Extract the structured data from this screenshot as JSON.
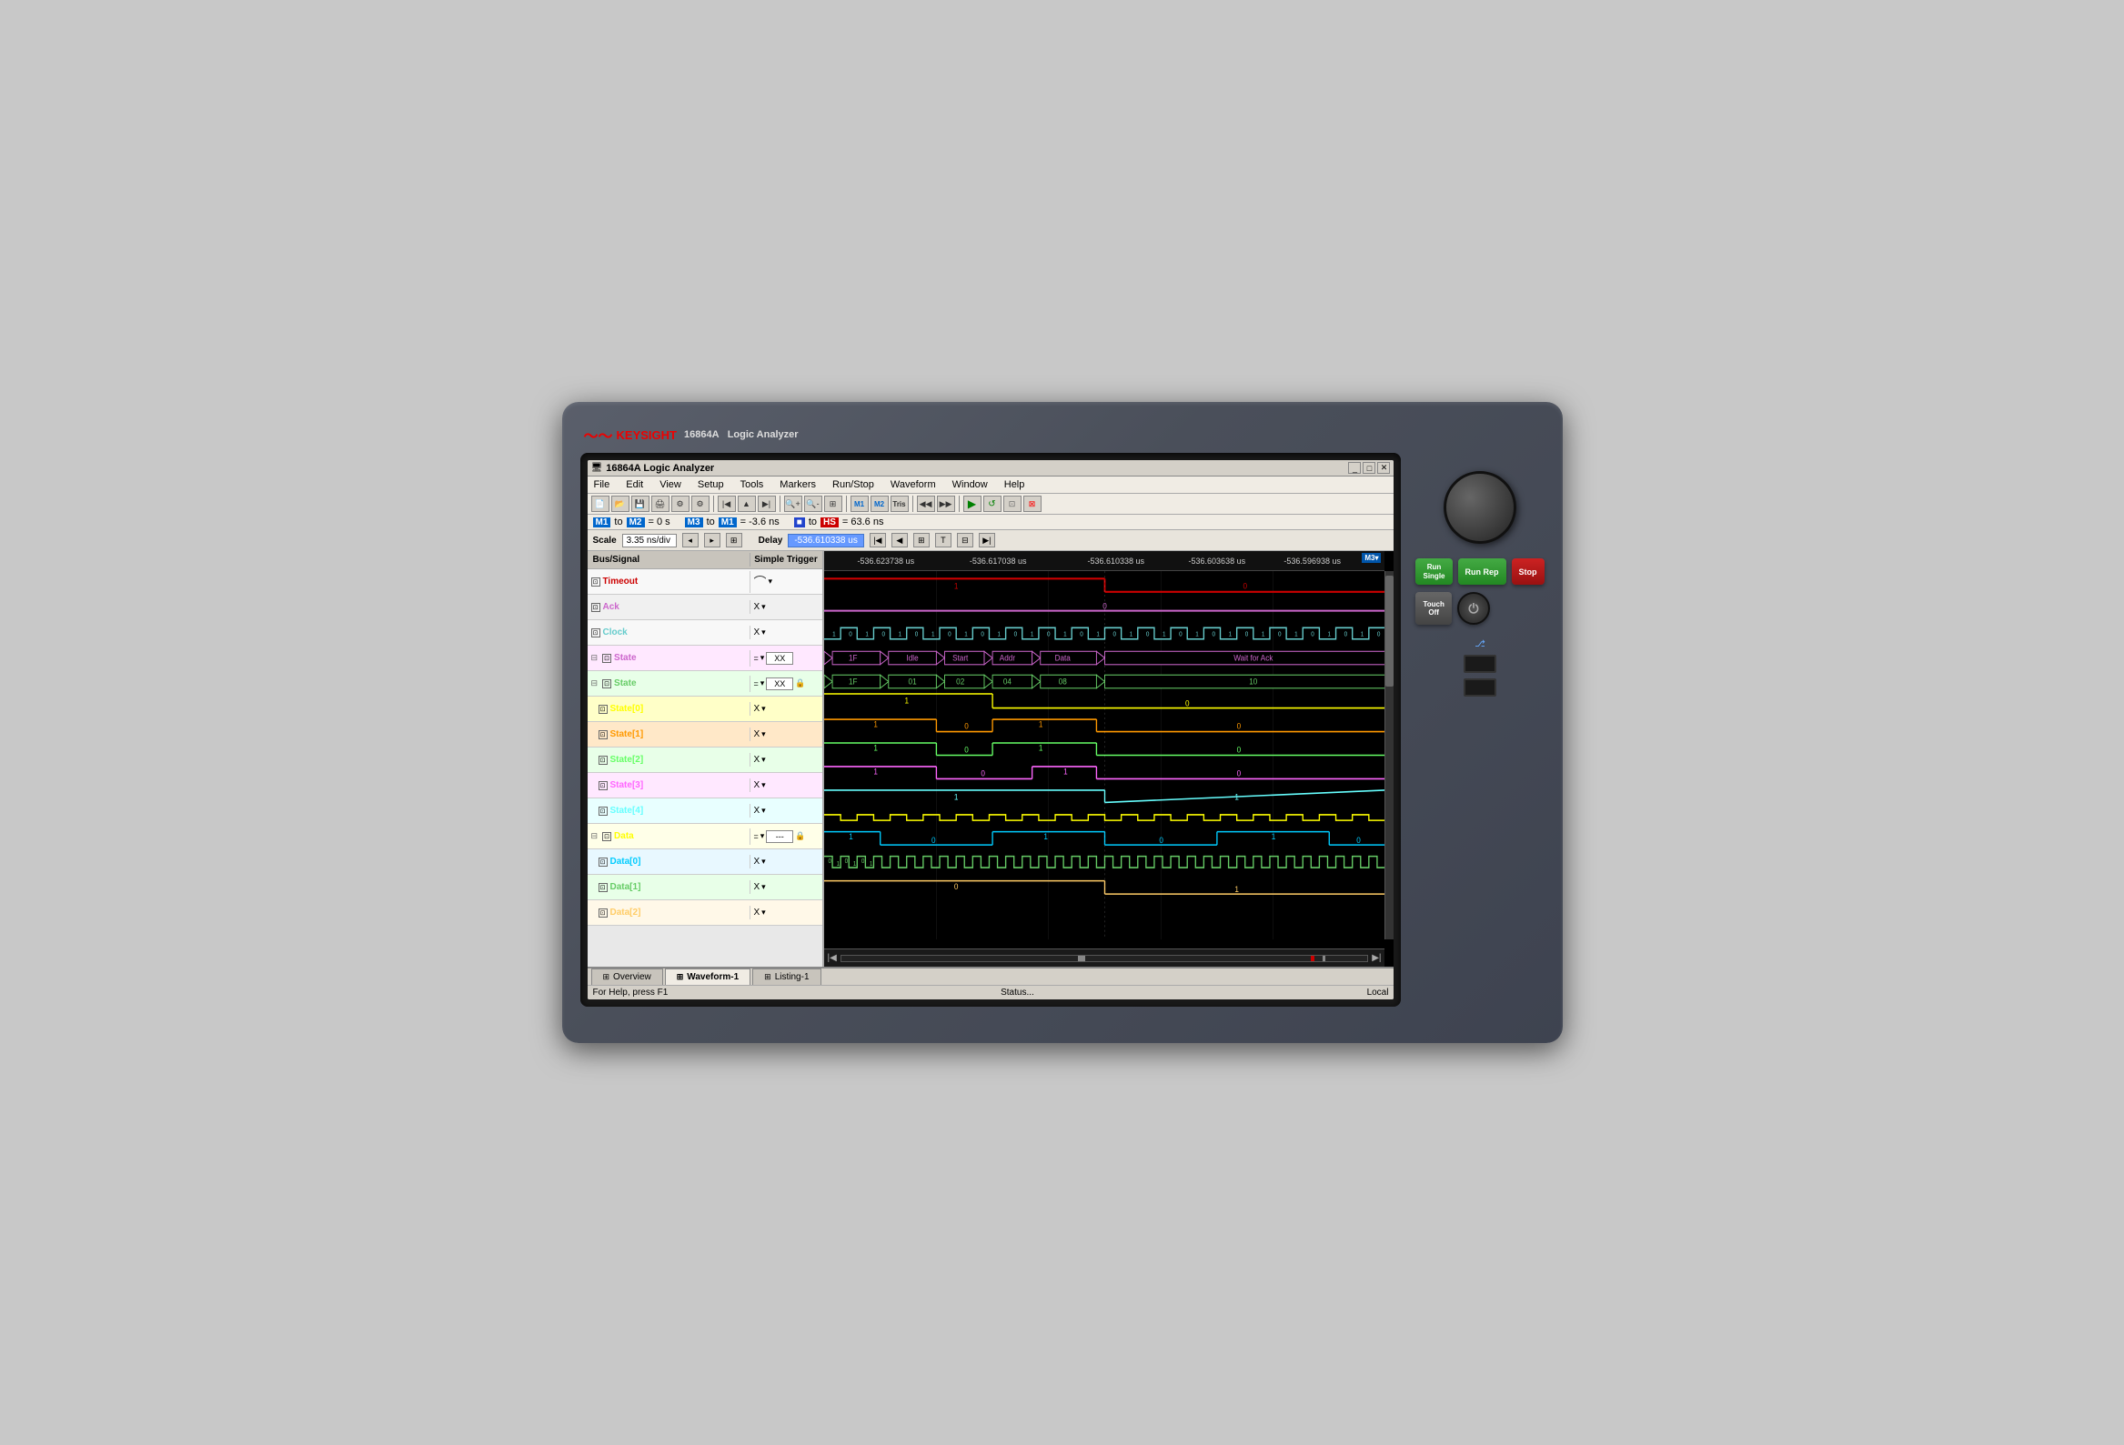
{
  "instrument": {
    "brand": "KEYSIGHT",
    "model": "16864A",
    "type": "Logic Analyzer"
  },
  "window": {
    "title": "16864A  Logic Analyzer",
    "min": "_",
    "max": "□",
    "close": "✕"
  },
  "menu": {
    "items": [
      "File",
      "Edit",
      "View",
      "Setup",
      "Tools",
      "Markers",
      "Run/Stop",
      "Waveform",
      "Window",
      "Help"
    ]
  },
  "status_row": {
    "m1_m2": "M1 to M2 = 0 s",
    "m3_m1": "M3 to M1 = -3.6 ns",
    "blue_hs": "to HS = 63.6 ns"
  },
  "scale_bar": {
    "scale_label": "Scale",
    "scale_value": "3.35 ns/div",
    "delay_label": "Delay",
    "delay_value": "-536.610338 us"
  },
  "timeline": {
    "t1": "-536.623738 us",
    "t2": "-536.617038 us",
    "t3": "-536.610338 us",
    "t4": "-536.603638 us",
    "t5": "-536.596938 us",
    "m3_badge": "M3▾"
  },
  "signals": [
    {
      "id": "timeout",
      "name": "Timeout",
      "indent": 0,
      "color": "timeout",
      "trigger_type": "rising",
      "trigger_val": ""
    },
    {
      "id": "ack",
      "name": "Ack",
      "indent": 0,
      "color": "ack",
      "trigger_type": "X",
      "trigger_val": ""
    },
    {
      "id": "clock",
      "name": "Clock",
      "indent": 0,
      "color": "clock",
      "trigger_type": "X",
      "trigger_val": ""
    },
    {
      "id": "state1",
      "name": "State",
      "indent": 0,
      "color": "state",
      "trigger_type": "eq",
      "trigger_val": "XX",
      "has_expand": true
    },
    {
      "id": "state2",
      "name": "State",
      "indent": 0,
      "color": "state2",
      "trigger_type": "eq",
      "trigger_val": "XX",
      "has_expand": true
    },
    {
      "id": "state0",
      "name": "State[0]",
      "indent": 1,
      "color": "state01",
      "trigger_type": "X",
      "trigger_val": ""
    },
    {
      "id": "state1b",
      "name": "State[1]",
      "indent": 1,
      "color": "state11",
      "trigger_type": "X",
      "trigger_val": ""
    },
    {
      "id": "state2b",
      "name": "State[2]",
      "indent": 1,
      "color": "state21",
      "trigger_type": "X",
      "trigger_val": ""
    },
    {
      "id": "state3",
      "name": "State[3]",
      "indent": 1,
      "color": "state31",
      "trigger_type": "X",
      "trigger_val": ""
    },
    {
      "id": "state4",
      "name": "State[4]",
      "indent": 1,
      "color": "state41",
      "trigger_type": "X",
      "trigger_val": ""
    },
    {
      "id": "data",
      "name": "Data",
      "indent": 0,
      "color": "data",
      "trigger_type": "eq",
      "trigger_val": "---",
      "has_expand": true
    },
    {
      "id": "data0",
      "name": "Data[0]",
      "indent": 1,
      "color": "data0",
      "trigger_type": "X",
      "trigger_val": ""
    },
    {
      "id": "data1",
      "name": "Data[1]",
      "indent": 1,
      "color": "data1",
      "trigger_type": "X",
      "trigger_val": ""
    },
    {
      "id": "data2",
      "name": "Data[2]",
      "indent": 1,
      "color": "data2",
      "trigger_type": "X",
      "trigger_val": ""
    }
  ],
  "waveform_labels": {
    "state1_segments": [
      "1F",
      "Idle",
      "Start",
      "Addr",
      "Data",
      "Wait for Ack"
    ],
    "state2_segments": [
      "1F",
      "01",
      "02",
      "04",
      "08",
      "10"
    ]
  },
  "bottom_tabs": [
    {
      "id": "overview",
      "label": "Overview",
      "icon": "⊞",
      "active": false
    },
    {
      "id": "waveform1",
      "label": "Waveform-1",
      "icon": "⊞",
      "active": true
    },
    {
      "id": "listing1",
      "label": "Listing-1",
      "icon": "⊞",
      "active": false
    }
  ],
  "footer": {
    "help": "For Help, press F1",
    "status": "Status...",
    "mode": "Local"
  },
  "buttons": {
    "run_single": "Run\nSingle",
    "run_rep": "Run Rep",
    "stop": "Stop",
    "touch_off": "Touch\nOff"
  }
}
